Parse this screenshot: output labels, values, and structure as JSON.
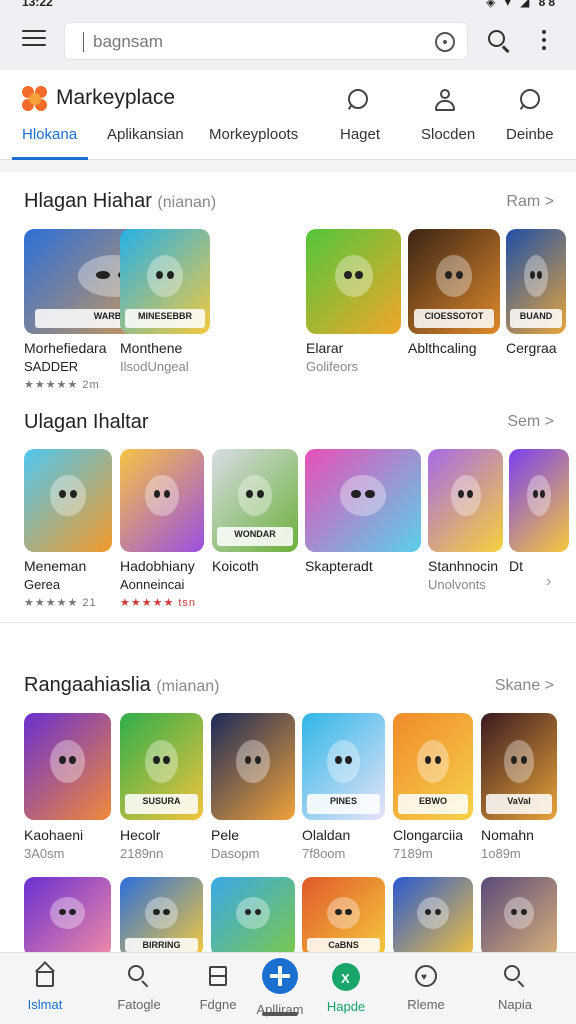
{
  "status_bar": {
    "time": "13:22",
    "indicators": "◈ ▾ ◢ 88"
  },
  "search": {
    "placeholder": "bagnsam"
  },
  "header": {
    "app_name": "Markeyplace"
  },
  "tabs": [
    {
      "label": "Hlokana"
    },
    {
      "label": "Aplikansian"
    },
    {
      "label": "Morkeyploots"
    },
    {
      "label": "Haget"
    },
    {
      "label": "Slocden"
    },
    {
      "label": "Deinbe"
    }
  ],
  "sections": [
    {
      "title": "Hlagan Hiahar",
      "subtitle": "(nianan)",
      "more": "Ram >",
      "items": [
        {
          "name": "Morhefiedara",
          "sub": "SADDER",
          "rating": "★★★★★ 2m",
          "banner": "WARBAR",
          "color_a": "#2d6fd8",
          "color_b": "#f2a23a"
        },
        {
          "name": "Monthene",
          "sub": "IlsodUngeal",
          "rating": "",
          "banner": "MINESEBBR",
          "color_a": "#26b0e8",
          "color_b": "#f5c93d"
        },
        {
          "name": "Elarar",
          "sub": "Golifeors",
          "rating": "",
          "banner": "",
          "color_a": "#53c63b",
          "color_b": "#f0a72a"
        },
        {
          "name": "Ablthcaling",
          "sub": "",
          "rating": "",
          "banner": "CIOESSOTOT",
          "color_a": "#3b2415",
          "color_b": "#e08a2c"
        },
        {
          "name": "Cergraa",
          "sub": "",
          "rating": "",
          "banner": "BUAND",
          "color_a": "#1e4fa8",
          "color_b": "#e7a53b"
        }
      ]
    },
    {
      "title": "Ulagan Ihaltar",
      "subtitle": "",
      "more": "Sem >",
      "items": [
        {
          "name": "Meneman",
          "sub": "Gerea",
          "rating": "★★★★★ 21",
          "rating_color": "grey",
          "banner": "",
          "color_a": "#4fc8f0",
          "color_b": "#f39a2a"
        },
        {
          "name": "Hadobhiany",
          "sub": "Aonneincai",
          "rating": "★★★★★ tsn",
          "rating_color": "red",
          "banner": "",
          "color_a": "#f6c445",
          "color_b": "#9a4fe0"
        },
        {
          "name": "Koicoth",
          "sub": "",
          "rating": "",
          "banner": "WONDAR",
          "color_a": "#d8dde4",
          "color_b": "#6bb03a"
        },
        {
          "name": "Skapteradt",
          "sub": "",
          "rating": "",
          "banner": "",
          "color_a": "#e84fb8",
          "color_b": "#5ad0e8"
        },
        {
          "name": "Stanhnocin",
          "sub": "Unolvonts",
          "rating": "",
          "banner": "",
          "color_a": "#a86ae8",
          "color_b": "#f5d03a"
        },
        {
          "name": "Dt",
          "sub": "",
          "rating": "",
          "banner": "",
          "color_a": "#7b3ff0",
          "color_b": "#f5c93d"
        }
      ]
    },
    {
      "title": "Rangaahiaslia",
      "subtitle": "(mianan)",
      "more": "Skane >",
      "items": [
        {
          "name": "Kaohaeni",
          "sub": "3A0sm",
          "color_a": "#6a2fd0",
          "color_b": "#f08a3a",
          "banner": ""
        },
        {
          "name": "Hecolr",
          "sub": "2189nn",
          "color_a": "#2fae4a",
          "color_b": "#f3c43d",
          "banner": "SUSURA"
        },
        {
          "name": "Pele",
          "sub": "Dasopm",
          "color_a": "#1c2a5a",
          "color_b": "#f0a23a",
          "banner": ""
        },
        {
          "name": "Olaldan",
          "sub": "7f8oom",
          "color_a": "#2fb6e8",
          "color_b": "#e8e4f8",
          "banner": "PINES"
        },
        {
          "name": "Clongarciia",
          "sub": "7189m",
          "color_a": "#f08a2a",
          "color_b": "#f6d24a",
          "banner": "EBWO"
        },
        {
          "name": "Nomahn",
          "sub": "1o89m",
          "color_a": "#3a1a20",
          "color_b": "#e8a43a",
          "banner": "VaVaI"
        }
      ]
    },
    {
      "items": [
        {
          "color_a": "#6a2fd0",
          "color_b": "#f08aa8",
          "banner": ""
        },
        {
          "color_a": "#2d6fd8",
          "color_b": "#f5c93d",
          "banner": "BIRRING"
        },
        {
          "color_a": "#3aa8e8",
          "color_b": "#7ac84a",
          "banner": ""
        },
        {
          "color_a": "#e05a2a",
          "color_b": "#f5c93d",
          "banner": "CaBNS"
        },
        {
          "color_a": "#2a5ad0",
          "color_b": "#f0c040",
          "banner": ""
        },
        {
          "color_a": "#5a4a7a",
          "color_b": "#d8b07a",
          "banner": ""
        }
      ]
    }
  ],
  "bottom_nav": [
    {
      "label": "Islmat",
      "icon": "home-icon",
      "state": "active"
    },
    {
      "label": "Fatogle",
      "icon": "search-icon",
      "state": ""
    },
    {
      "label": "Fdgne",
      "icon": "grid-icon",
      "state": ""
    },
    {
      "label": "Aplliram",
      "icon": "plus-icon",
      "state": ""
    },
    {
      "label": "Hapde",
      "icon": "app-icon",
      "state": "green"
    },
    {
      "label": "Rleme",
      "icon": "heart-icon",
      "state": ""
    },
    {
      "label": "Napia",
      "icon": "magnifier-icon",
      "state": ""
    }
  ]
}
